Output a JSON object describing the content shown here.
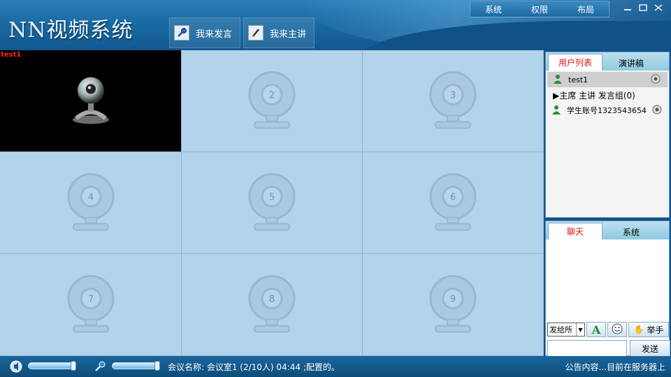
{
  "app": {
    "title": "NN视频系统"
  },
  "header": {
    "actions": [
      {
        "label": "我来发言",
        "icon": "microphone-icon"
      },
      {
        "label": "我来主讲",
        "icon": "pen-icon"
      }
    ],
    "menu": [
      "系统",
      "权限",
      "布局"
    ]
  },
  "video_grid": {
    "cells": [
      {
        "label": "test1",
        "number": "",
        "active": true
      },
      {
        "number": "2"
      },
      {
        "number": "3"
      },
      {
        "number": "4"
      },
      {
        "number": "5"
      },
      {
        "number": "6"
      },
      {
        "number": "7"
      },
      {
        "number": "8"
      },
      {
        "number": "9"
      }
    ]
  },
  "users_panel": {
    "tabs": [
      {
        "label": "用户列表",
        "active": true
      },
      {
        "label": "演讲稿",
        "active": false
      }
    ],
    "users": [
      {
        "name": "test1",
        "icon": "user-icon",
        "selected": true
      },
      {
        "name": "学生账号1323543654",
        "icon": "user-icon",
        "selected": false
      }
    ],
    "group_label": "▶主席 主讲 发言组(0)"
  },
  "chat_panel": {
    "tabs": [
      {
        "label": "聊天",
        "active": true
      },
      {
        "label": "系统",
        "active": false
      }
    ],
    "recipient": "发给所",
    "raise_hand_label": "举手",
    "send_label": "发送"
  },
  "status_bar": {
    "meeting_info": "会议名称: 会议室1 (2/10人) 04:44 ;配置的。",
    "notice": "公告内容...目前在服务器上"
  },
  "colors": {
    "accent": "#1b6aa3",
    "active_tab_text": "#e01010",
    "cell_bg": "#b3d3ea"
  }
}
